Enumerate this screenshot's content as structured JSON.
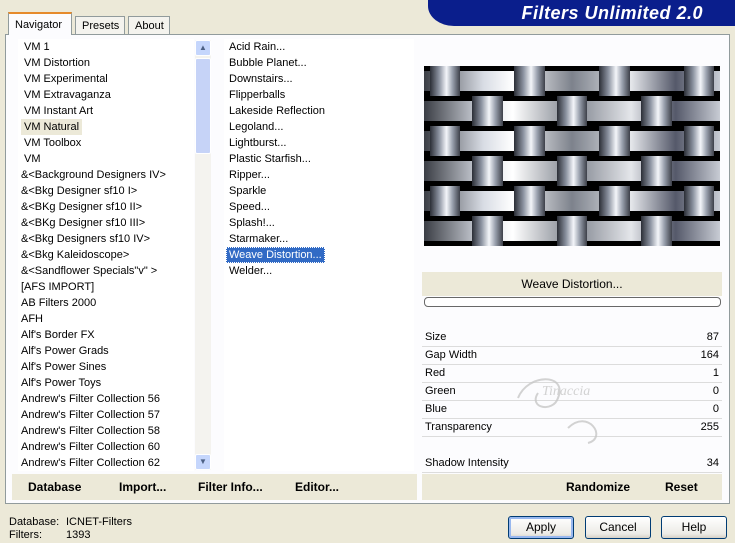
{
  "tabs": [
    "Navigator",
    "Presets",
    "About"
  ],
  "banner_title": "Filters Unlimited 2.0",
  "categories": [
    "VM 1",
    "VM Distortion",
    "VM Experimental",
    "VM Extravaganza",
    "VM Instant Art",
    "VM Natural",
    "VM Toolbox",
    "VM",
    "&<Background Designers IV>",
    "&<Bkg Designer sf10 I>",
    "&<BKg Designer sf10 II>",
    "&<BKg Designer sf10 III>",
    "&<Bkg Designers sf10 IV>",
    "&<Bkg Kaleidoscope>",
    "&<Sandflower Specials\"v\" >",
    "[AFS IMPORT]",
    "AB Filters 2000",
    "AFH",
    "Alf's Border FX",
    "Alf's Power Grads",
    "Alf's Power Sines",
    "Alf's Power Toys",
    "Andrew's Filter Collection 56",
    "Andrew's Filter Collection 57",
    "Andrew's Filter Collection 58",
    "Andrew's Filter Collection 60",
    "Andrew's Filter Collection 62"
  ],
  "selected_category_index": 5,
  "filters": [
    "Acid Rain...",
    "Bubble Planet...",
    "Downstairs...",
    "Flipperballs",
    "Lakeside Reflection",
    "Legoland...",
    "Lightburst...",
    "Plastic Starfish...",
    "Ripper...",
    "Sparkle",
    "Speed...",
    "Splash!...",
    "Starmaker...",
    "Weave Distortion...",
    "Welder..."
  ],
  "selected_filter_index": 13,
  "filter_name": "Weave Distortion...",
  "params": [
    {
      "name": "Size",
      "value": "87"
    },
    {
      "name": "Gap Width",
      "value": "164"
    },
    {
      "name": "Red",
      "value": "1"
    },
    {
      "name": "Green",
      "value": "0"
    },
    {
      "name": "Blue",
      "value": "0"
    },
    {
      "name": "Transparency",
      "value": "255"
    }
  ],
  "shadow_param": {
    "name": "Shadow Intensity",
    "value": "34"
  },
  "watermark": "Tinaccia",
  "bottom_left": {
    "database": "Database",
    "import": "Import...",
    "filter_info": "Filter Info...",
    "editor": "Editor..."
  },
  "bottom_right": {
    "randomize": "Randomize",
    "reset": "Reset"
  },
  "status": {
    "db_label": "Database:",
    "db_value": "ICNET-Filters",
    "filters_label": "Filters:",
    "filters_value": "1393"
  },
  "buttons": {
    "apply": "Apply",
    "cancel": "Cancel",
    "help": "Help"
  },
  "colors": {
    "banner": "#0a1e8c",
    "selection": "#316ac5",
    "face": "#ece9d8"
  }
}
